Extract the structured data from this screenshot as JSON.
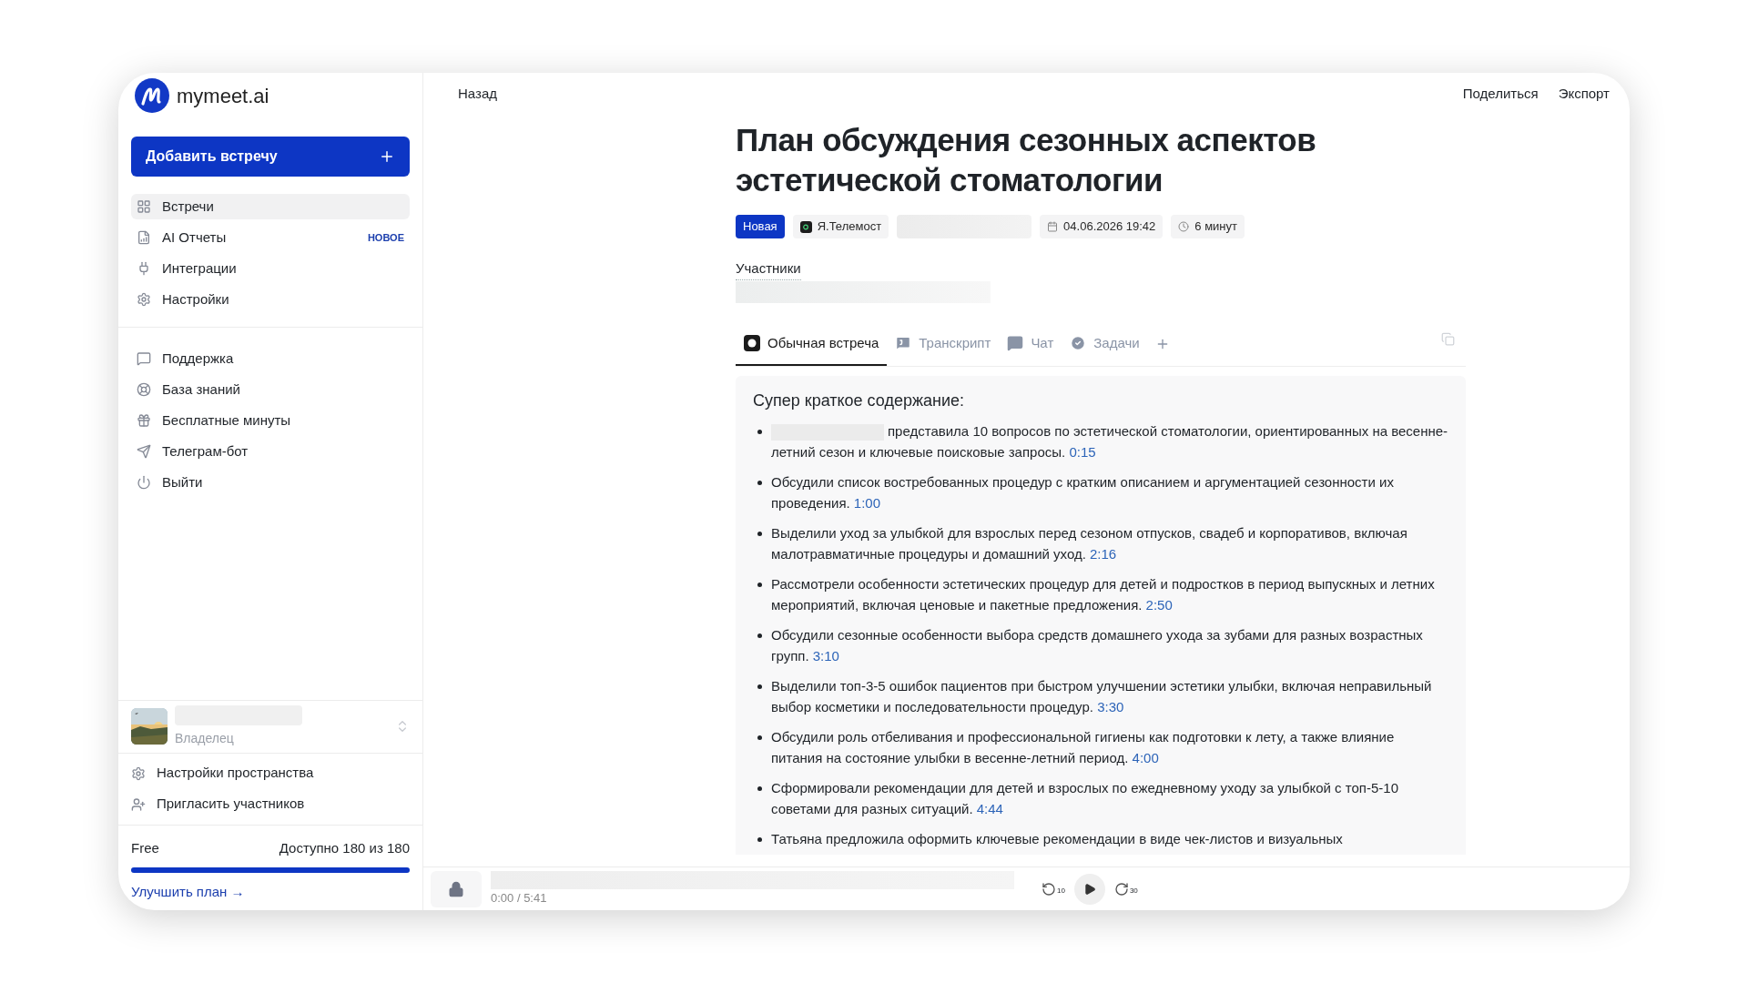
{
  "sidebar": {
    "logo": "mymeet.ai",
    "add_button": "Добавить встречу",
    "nav": [
      {
        "label": "Встречи",
        "selected": true
      },
      {
        "label": "AI Отчеты",
        "selected": false,
        "badge": "НОВОЕ"
      },
      {
        "label": "Интеграции",
        "selected": false
      },
      {
        "label": "Настройки",
        "selected": false
      }
    ],
    "secondary": [
      {
        "label": "Поддержка"
      },
      {
        "label": "База знаний"
      },
      {
        "label": "Бесплатные минуты"
      },
      {
        "label": "Телеграм-бот"
      },
      {
        "label": "Выйти"
      }
    ],
    "workspace": {
      "role": "Владелец"
    },
    "workspace_items": [
      {
        "label": "Настройки пространства"
      },
      {
        "label": "Пригласить участников"
      }
    ],
    "plan": {
      "name": "Free",
      "availability": "Доступно 180 из 180",
      "level": 1
    },
    "upgrade": "Улучшить план →"
  },
  "header": {
    "back": "Назад",
    "actions": [
      "Поделиться",
      "Экспорт"
    ]
  },
  "meeting": {
    "title": "План обсуждения сезонных аспектов эстетической стоматологии",
    "chips": [
      {
        "kind": "status",
        "text": "Новая"
      },
      {
        "kind": "platform",
        "text": "Я.Телемост"
      },
      {
        "kind": "redacted"
      },
      {
        "kind": "date",
        "text": "04.06.2026 19:42"
      },
      {
        "kind": "duration",
        "text": "6 минут"
      }
    ],
    "participants_label": "Участники"
  },
  "tabs": [
    {
      "label": "Обычная встреча",
      "selected": true
    },
    {
      "label": "Транскрипт",
      "selected": false
    },
    {
      "label": "Чат",
      "selected": false
    },
    {
      "label": "Задачи",
      "selected": false
    }
  ],
  "summary": {
    "heading": "Супер краткое содержание:",
    "bullets": [
      {
        "redacted_name": true,
        "text": "представила 10 вопросов по эстетической стоматологии, ориентированных на весенне-летний сезон и ключевые поисковые запросы.",
        "time": "0:15"
      },
      {
        "text": "Обсудили список востребованных процедур с кратким описанием и аргументацией сезонности их проведения.",
        "time": "1:00"
      },
      {
        "text": "Выделили уход за улыбкой для взрослых перед сезоном отпусков, свадеб и корпоративов, включая малотравматичные процедуры и домашний уход.",
        "time": "2:16"
      },
      {
        "text": "Рассмотрели особенности эстетических процедур для детей и подростков в период выпускных и летних мероприятий, включая ценовые и пакетные предложения.",
        "time": "2:50"
      },
      {
        "text": "Обсудили сезонные особенности выбора средств домашнего ухода за зубами для разных возрастных групп.",
        "time": "3:10"
      },
      {
        "text": "Выделили топ-3-5 ошибок пациентов при быстром улучшении эстетики улыбки, включая неправильный выбор косметики и последовательности процедур.",
        "time": "3:30"
      },
      {
        "text": "Обсудили роль отбеливания и профессиональной гигиены как подготовки к лету, а также влияние питания на состояние улыбки в весенне-летний период.",
        "time": "4:00"
      },
      {
        "text": "Сформировали рекомендации для детей и взрослых по ежедневному уходу за улыбкой с топ-5-10 советами для разных ситуаций.",
        "time": "4:44"
      },
      {
        "text": "Татьяна предложила оформить ключевые рекомендации в виде чек-листов и визуальных"
      }
    ]
  },
  "player": {
    "time": "0:00 / 5:41",
    "back_seconds": "10",
    "forward_seconds": "30"
  }
}
